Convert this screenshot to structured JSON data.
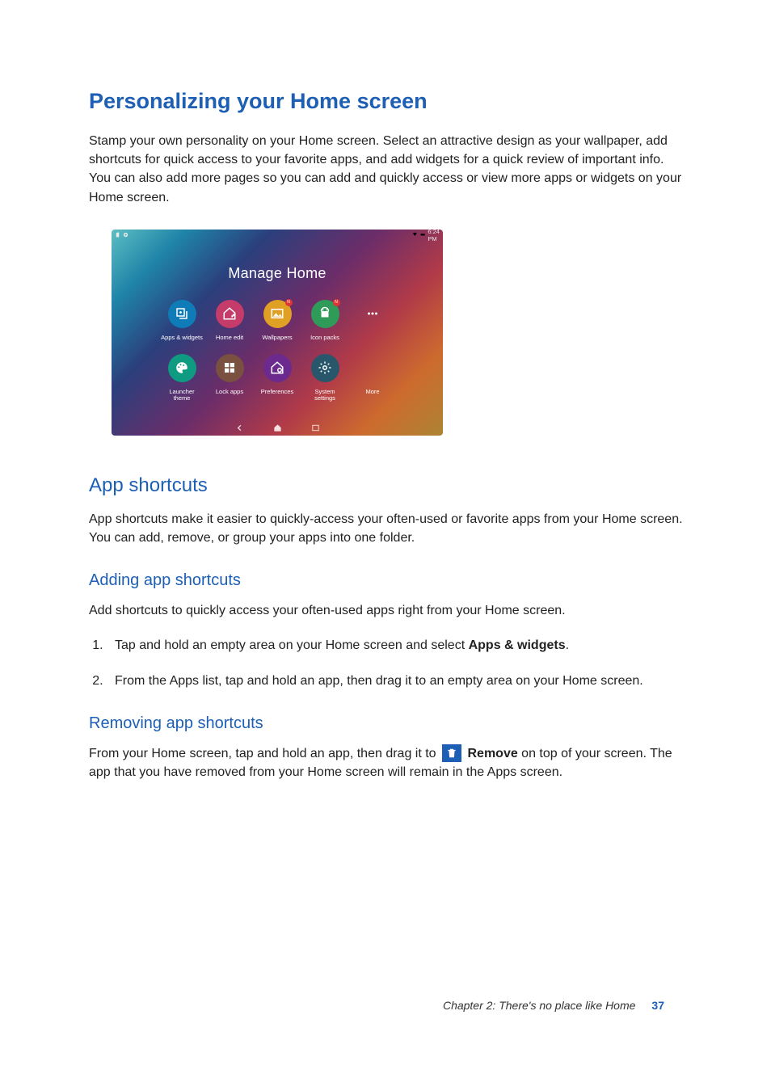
{
  "headings": {
    "h1": "Personalizing your Home screen",
    "app_shortcuts": "App shortcuts",
    "adding": "Adding app shortcuts",
    "removing": "Removing app shortcuts"
  },
  "paragraphs": {
    "intro": "Stamp your own personality on your Home screen. Select an attractive design as your wallpaper, add shortcuts for quick access to your favorite apps, and add widgets for a quick review of important info. You can also add more pages so you can add and quickly access or view more apps or widgets on your Home screen.",
    "app_shortcuts": "App shortcuts make it easier to quickly-access your often-used or favorite apps from your Home screen. You can add, remove, or group your apps into one folder.",
    "adding_intro": "Add shortcuts to quickly access your often-used apps right from your Home screen.",
    "step1_part1": "Tap and hold an empty area on your Home screen and select ",
    "step1_bold": "Apps & widgets",
    "step1_part2": ".",
    "step2": "From the Apps list, tap and hold an app, then drag it to an empty area on your Home screen.",
    "removing_part1": "From your Home screen, tap and hold an app, then drag it to ",
    "removing_bold": "Remove",
    "removing_part2": " on top of your screen. The app that you have removed from your Home screen will remain in the Apps screen."
  },
  "screenshot": {
    "status_time": "6:24 PM",
    "title": "Manage Home",
    "items": [
      {
        "label": "Apps & widgets",
        "color": "#0f7cb8",
        "icon": "plus-card"
      },
      {
        "label": "Home edit",
        "color": "#c53b6a",
        "icon": "home-pen"
      },
      {
        "label": "Wallpapers",
        "color": "#e0a024",
        "icon": "picture",
        "badge": "N"
      },
      {
        "label": "Icon packs",
        "color": "#2f9b59",
        "icon": "android",
        "badge": "N"
      },
      {
        "label": "",
        "color": "transparent",
        "icon": "dots"
      },
      {
        "label": "Launcher\ntheme",
        "color": "#0e9b82",
        "icon": "palette"
      },
      {
        "label": "Lock apps",
        "color": "#7a5040",
        "icon": "tiles"
      },
      {
        "label": "Preferences",
        "color": "#6c2a8f",
        "icon": "home-gear"
      },
      {
        "label": "System\nsettings",
        "color": "#28576c",
        "icon": "gear"
      },
      {
        "label": "More",
        "color": "transparent",
        "icon": "none"
      }
    ]
  },
  "footer": {
    "chapter": "Chapter 2: There's no place like Home",
    "page_no": "37"
  }
}
